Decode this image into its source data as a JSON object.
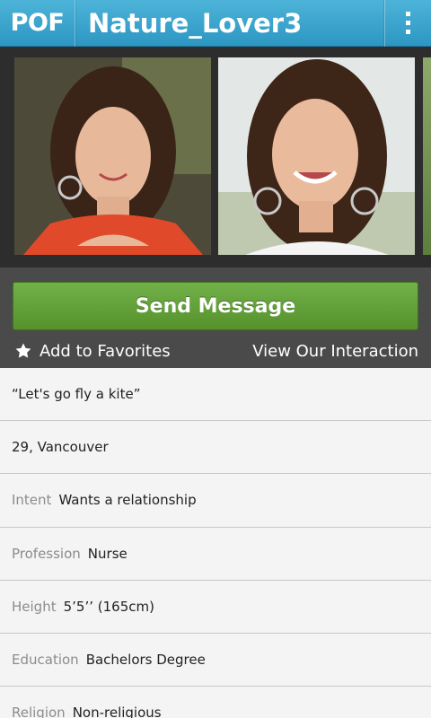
{
  "header": {
    "logo": "POF",
    "title": "Nature_Lover3"
  },
  "actions": {
    "send_message": "Send Message",
    "add_favorites": "Add to Favorites",
    "view_interaction": "View Our Interaction"
  },
  "profile": {
    "headline": "“Let's go fly a kite”",
    "age_location": "29, Vancouver",
    "details": [
      {
        "label": "Intent",
        "value": "Wants a relationship"
      },
      {
        "label": "Profession",
        "value": "Nurse"
      },
      {
        "label": "Height",
        "value": "5’5’’ (165cm)"
      },
      {
        "label": "Education",
        "value": "Bachelors Degree"
      },
      {
        "label": "Religion",
        "value": "Non-religious"
      }
    ]
  },
  "icons": {
    "menu": "overflow-menu-icon",
    "favorite": "star-icon"
  }
}
